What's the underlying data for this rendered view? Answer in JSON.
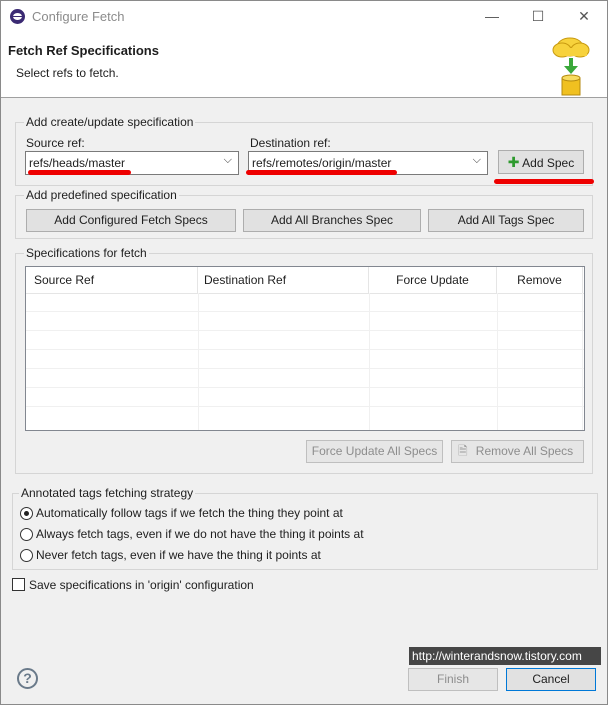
{
  "window": {
    "title": "Configure Fetch",
    "minimize_glyph": "—",
    "maximize_glyph": "☐",
    "close_glyph": "✕"
  },
  "banner": {
    "title": "Fetch Ref Specifications",
    "description": "Select refs to fetch."
  },
  "create_group": {
    "label": "Add create/update specification",
    "source_label": "Source ref:",
    "source_value": "refs/heads/master",
    "dest_label": "Destination ref:",
    "dest_value": "refs/remotes/origin/master",
    "add_spec_label": "Add Spec"
  },
  "predefined_group": {
    "label": "Add predefined specification",
    "buttons": [
      "Add Configured Fetch Specs",
      "Add All Branches Spec",
      "Add All Tags Spec"
    ]
  },
  "specs_group": {
    "label": "Specifications for fetch",
    "columns": [
      "Source Ref",
      "Destination Ref",
      "Force Update",
      "Remove"
    ],
    "force_update_all_label": "Force Update All Specs",
    "remove_all_label": "Remove All Specs"
  },
  "tags_group": {
    "label": "Annotated tags fetching strategy",
    "options": [
      {
        "label": "Automatically follow tags if we fetch the thing they point at",
        "checked": true
      },
      {
        "label": "Always fetch tags, even if we do not have the thing it points at",
        "checked": false
      },
      {
        "label": "Never fetch tags, even if we have the thing it points at",
        "checked": false
      }
    ]
  },
  "save_checkbox": {
    "label": "Save specifications in 'origin' configuration",
    "checked": false
  },
  "footer": {
    "help_glyph": "?",
    "finish_label": "Finish",
    "cancel_label": "Cancel"
  },
  "watermark": "http://winterandsnow.tistory.com",
  "colors": {
    "highlight_mark": "#ee0000",
    "accent": "#3b2a73"
  }
}
